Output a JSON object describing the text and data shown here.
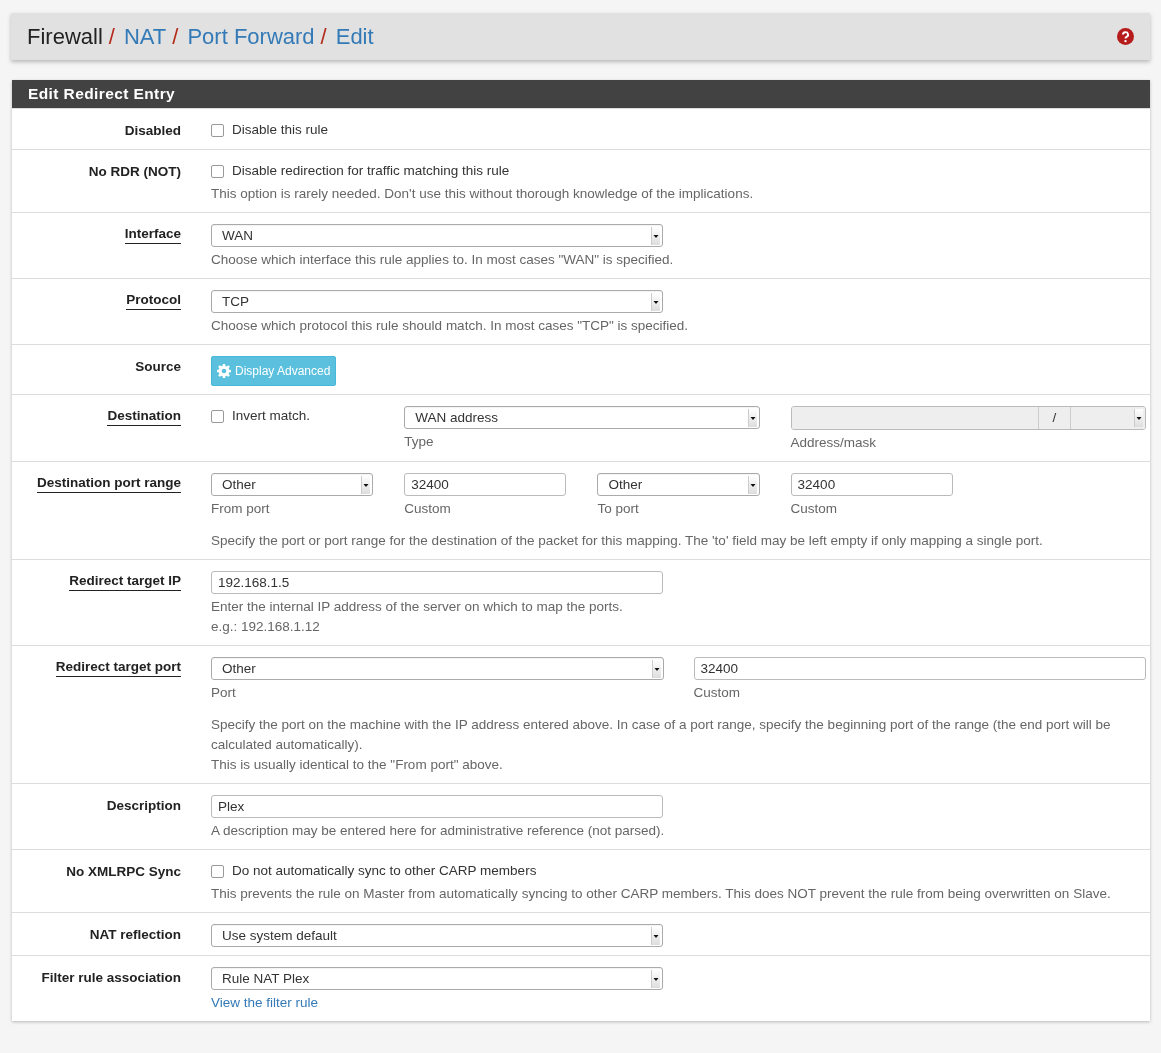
{
  "breadcrumb": {
    "separator": "/",
    "items": [
      {
        "label": "Firewall",
        "link": false
      },
      {
        "label": "NAT",
        "link": true
      },
      {
        "label": "Port Forward",
        "link": true
      },
      {
        "label": "Edit",
        "link": true
      }
    ]
  },
  "panel": {
    "title": "Edit Redirect Entry",
    "rows": [
      {
        "label": "Disabled",
        "underlined": false,
        "kind": "stack",
        "fields": [
          {
            "kind": "checkbox",
            "label": "Disable this rule",
            "checked": false
          }
        ],
        "help": []
      },
      {
        "label": "No RDR (NOT)",
        "underlined": false,
        "kind": "stack",
        "fields": [
          {
            "kind": "checkbox",
            "label": "Disable redirection for traffic matching this rule",
            "checked": false
          }
        ],
        "help": [
          "This option is rarely needed. Don't use this without thorough knowledge of the implications."
        ]
      },
      {
        "label": "Interface",
        "underlined": true,
        "kind": "stack",
        "fields": [
          {
            "kind": "select",
            "value": "WAN",
            "disabled": false
          }
        ],
        "help": [
          "Choose which interface this rule applies to. In most cases \"WAN\" is specified."
        ]
      },
      {
        "label": "Protocol",
        "underlined": true,
        "kind": "stack",
        "fields": [
          {
            "kind": "select",
            "value": "TCP",
            "disabled": false
          }
        ],
        "help": [
          "Choose which protocol this rule should match. In most cases \"TCP\" is specified."
        ]
      },
      {
        "label": "Source",
        "underlined": false,
        "kind": "stack",
        "fields": [
          {
            "kind": "button",
            "label": "Display Advanced"
          }
        ],
        "help": []
      },
      {
        "label": "Destination",
        "underlined": true,
        "kind": "destination",
        "fields": [
          {
            "kind": "checkbox",
            "label": "Invert match.",
            "checked": false
          },
          {
            "kind": "select",
            "value": "WAN address",
            "disabled": false,
            "caption": "Type"
          },
          {
            "kind": "address",
            "separator": "/",
            "disabled": true,
            "caption": "Address/mask"
          }
        ],
        "help": []
      },
      {
        "label": "Destination port range",
        "underlined": true,
        "kind": "grid",
        "fields": [
          {
            "kind": "select",
            "value": "Other",
            "disabled": false,
            "caption": "From port"
          },
          {
            "kind": "input",
            "value": "32400",
            "caption": "Custom"
          },
          {
            "kind": "select",
            "value": "Other",
            "disabled": false,
            "caption": "To port"
          },
          {
            "kind": "input",
            "value": "32400",
            "caption": "Custom"
          }
        ],
        "help": [
          "Specify the port or port range for the destination of the packet for this mapping. The 'to' field may be left empty if only mapping a single port."
        ]
      },
      {
        "label": "Redirect target IP",
        "underlined": true,
        "kind": "stack",
        "fields": [
          {
            "kind": "input",
            "value": "192.168.1.5"
          }
        ],
        "help": [
          "Enter the internal IP address of the server on which to map the ports.",
          "e.g.: 192.168.1.12"
        ]
      },
      {
        "label": "Redirect target port",
        "underlined": true,
        "kind": "split",
        "fields": [
          {
            "kind": "select",
            "value": "Other",
            "disabled": false,
            "caption": "Port"
          },
          {
            "kind": "input",
            "value": "32400",
            "caption": "Custom"
          }
        ],
        "help": [
          "Specify the port on the machine with the IP address entered above. In case of a port range, specify the beginning port of the range (the end port will be calculated automatically).",
          "This is usually identical to the \"From port\" above."
        ]
      },
      {
        "label": "Description",
        "underlined": false,
        "kind": "stack",
        "fields": [
          {
            "kind": "input",
            "value": "Plex"
          }
        ],
        "help": [
          "A description may be entered here for administrative reference (not parsed)."
        ]
      },
      {
        "label": "No XMLRPC Sync",
        "underlined": false,
        "kind": "stack",
        "fields": [
          {
            "kind": "checkbox",
            "label": "Do not automatically sync to other CARP members",
            "checked": false
          }
        ],
        "help": [
          "This prevents the rule on Master from automatically syncing to other CARP members. This does NOT prevent the rule from being overwritten on Slave."
        ]
      },
      {
        "label": "NAT reflection",
        "underlined": false,
        "kind": "stack",
        "fields": [
          {
            "kind": "select",
            "value": "Use system default",
            "disabled": false
          }
        ],
        "help": []
      },
      {
        "label": "Filter rule association",
        "underlined": false,
        "kind": "stack",
        "fields": [
          {
            "kind": "select",
            "value": "Rule NAT Plex",
            "disabled": false
          }
        ],
        "help": [],
        "link": "View the filter rule"
      }
    ]
  }
}
